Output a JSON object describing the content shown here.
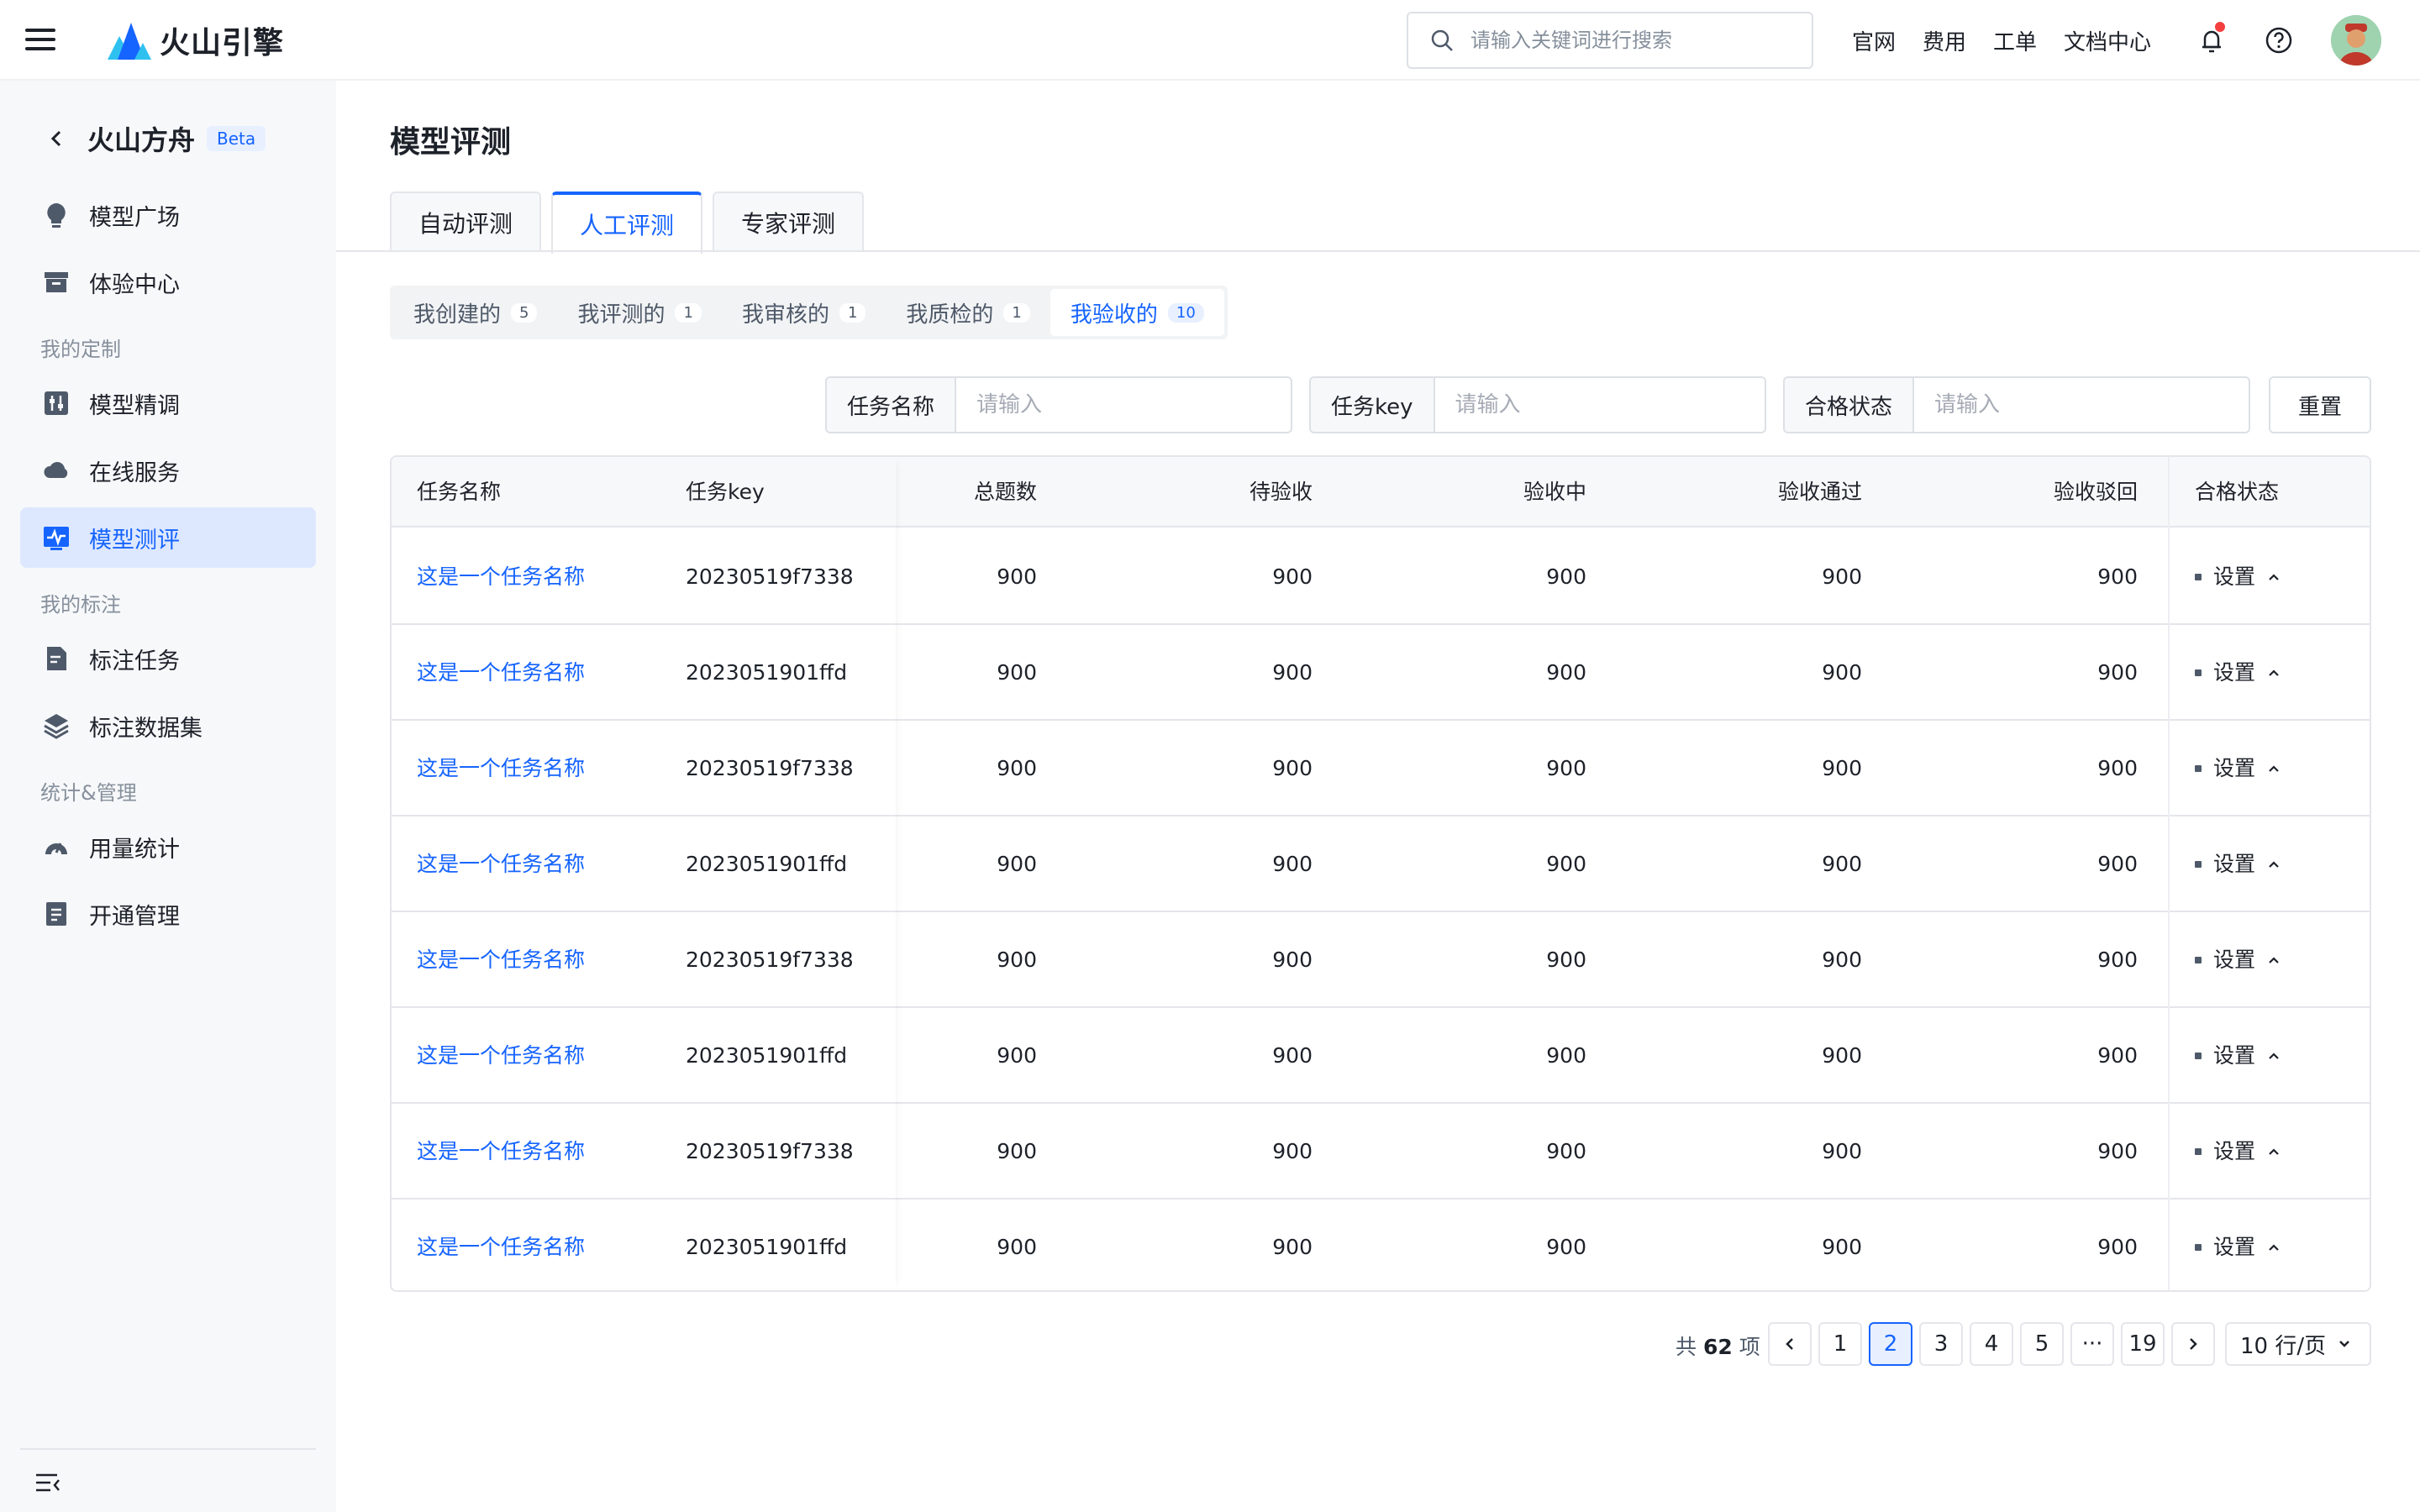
{
  "header": {
    "logo_text": "火山引擎",
    "search_placeholder": "请输入关键词进行搜索",
    "nav": [
      "官网",
      "费用",
      "工单",
      "文档中心"
    ]
  },
  "sidebar": {
    "title": "火山方舟",
    "badge": "Beta",
    "items": [
      {
        "label": "模型广场",
        "icon": "bulb-icon"
      },
      {
        "label": "体验中心",
        "icon": "box-icon"
      },
      {
        "label": "模型精调",
        "icon": "tune-icon"
      },
      {
        "label": "在线服务",
        "icon": "cloud-icon"
      },
      {
        "label": "模型测评",
        "icon": "pulse-icon"
      },
      {
        "label": "标注任务",
        "icon": "file-edit-icon"
      },
      {
        "label": "标注数据集",
        "icon": "layers-icon"
      },
      {
        "label": "用量统计",
        "icon": "gauge-icon"
      },
      {
        "label": "开通管理",
        "icon": "doc-list-icon"
      }
    ],
    "groups": [
      "我的定制",
      "我的标注",
      "统计&管理"
    ]
  },
  "main": {
    "title": "模型评测",
    "tabs": [
      "自动评测",
      "人工评测",
      "专家评测"
    ],
    "segments": [
      {
        "label": "我创建的",
        "count": "5"
      },
      {
        "label": "我评测的",
        "count": "1"
      },
      {
        "label": "我审核的",
        "count": "1"
      },
      {
        "label": "我质检的",
        "count": "1"
      },
      {
        "label": "我验收的",
        "count": "10"
      }
    ],
    "filters": [
      {
        "label": "任务名称",
        "placeholder": "请输入"
      },
      {
        "label": "任务key",
        "placeholder": "请输入"
      },
      {
        "label": "合格状态",
        "placeholder": "请输入"
      }
    ],
    "reset_label": "重置"
  },
  "table": {
    "columns": [
      "任务名称",
      "任务key",
      "总题数",
      "待验收",
      "验收中",
      "验收通过",
      "验收驳回",
      "合格状态"
    ],
    "rows": [
      {
        "name": "这是一个任务名称",
        "key": "20230519f7338",
        "total": "900",
        "pending": "900",
        "in_progress": "900",
        "passed": "900",
        "rejected": "900",
        "status": "设置"
      },
      {
        "name": "这是一个任务名称",
        "key": "2023051901ffd",
        "total": "900",
        "pending": "900",
        "in_progress": "900",
        "passed": "900",
        "rejected": "900",
        "status": "设置"
      },
      {
        "name": "这是一个任务名称",
        "key": "20230519f7338",
        "total": "900",
        "pending": "900",
        "in_progress": "900",
        "passed": "900",
        "rejected": "900",
        "status": "设置"
      },
      {
        "name": "这是一个任务名称",
        "key": "2023051901ffd",
        "total": "900",
        "pending": "900",
        "in_progress": "900",
        "passed": "900",
        "rejected": "900",
        "status": "设置"
      },
      {
        "name": "这是一个任务名称",
        "key": "20230519f7338",
        "total": "900",
        "pending": "900",
        "in_progress": "900",
        "passed": "900",
        "rejected": "900",
        "status": "设置"
      },
      {
        "name": "这是一个任务名称",
        "key": "2023051901ffd",
        "total": "900",
        "pending": "900",
        "in_progress": "900",
        "passed": "900",
        "rejected": "900",
        "status": "设置"
      },
      {
        "name": "这是一个任务名称",
        "key": "20230519f7338",
        "total": "900",
        "pending": "900",
        "in_progress": "900",
        "passed": "900",
        "rejected": "900",
        "status": "设置"
      },
      {
        "name": "这是一个任务名称",
        "key": "2023051901ffd",
        "total": "900",
        "pending": "900",
        "in_progress": "900",
        "passed": "900",
        "rejected": "900",
        "status": "设置"
      }
    ]
  },
  "pagination": {
    "total_prefix": "共",
    "total": "62",
    "total_suffix": "项",
    "pages": [
      "1",
      "2",
      "3",
      "4",
      "5",
      "···",
      "19"
    ],
    "current": "2",
    "page_size": "10 行/页"
  },
  "colors": {
    "accent": "#1664ff",
    "link": "#1664ff",
    "notification": "#f53f3f"
  }
}
